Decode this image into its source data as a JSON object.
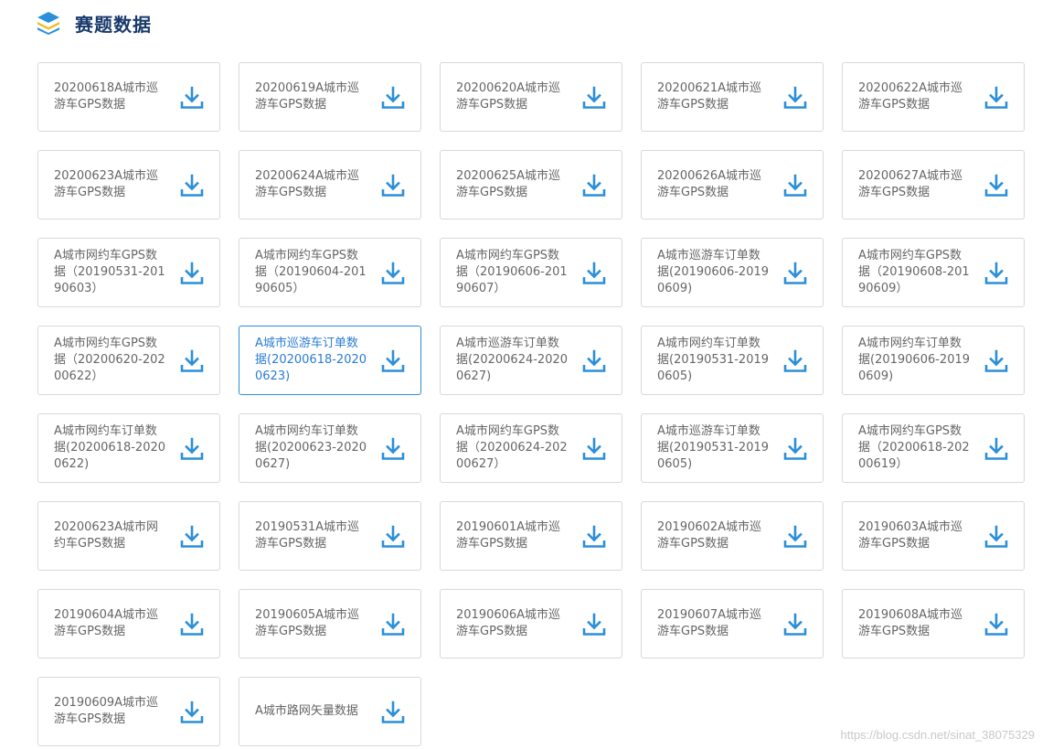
{
  "header": {
    "title": "赛题数据",
    "icon": "layers-icon"
  },
  "accent_color": "#2b8fd9",
  "items": [
    {
      "label": "20200618A城市巡游车GPS数据"
    },
    {
      "label": "20200619A城市巡游车GPS数据"
    },
    {
      "label": "20200620A城市巡游车GPS数据"
    },
    {
      "label": "20200621A城市巡游车GPS数据"
    },
    {
      "label": "20200622A城市巡游车GPS数据"
    },
    {
      "label": "20200623A城市巡游车GPS数据"
    },
    {
      "label": "20200624A城市巡游车GPS数据"
    },
    {
      "label": "20200625A城市巡游车GPS数据"
    },
    {
      "label": "20200626A城市巡游车GPS数据"
    },
    {
      "label": "20200627A城市巡游车GPS数据"
    },
    {
      "label": "A城市网约车GPS数据（20190531-20190603）"
    },
    {
      "label": "A城市网约车GPS数据（20190604-20190605）"
    },
    {
      "label": "A城市网约车GPS数据（20190606-20190607）"
    },
    {
      "label": "A城市巡游车订单数据(20190606-20190609)"
    },
    {
      "label": "A城市网约车GPS数据（20190608-20190609）"
    },
    {
      "label": "A城市网约车GPS数据（20200620-20200622）"
    },
    {
      "label": "A城市巡游车订单数据(20200618-20200623)",
      "active": true
    },
    {
      "label": "A城市巡游车订单数据(20200624-20200627)"
    },
    {
      "label": "A城市网约车订单数据(20190531-20190605)"
    },
    {
      "label": "A城市网约车订单数据(20190606-20190609)"
    },
    {
      "label": "A城市网约车订单数据(20200618-20200622)"
    },
    {
      "label": "A城市网约车订单数据(20200623-20200627)"
    },
    {
      "label": "A城市网约车GPS数据（20200624-20200627）"
    },
    {
      "label": "A城市巡游车订单数据(20190531-20190605)"
    },
    {
      "label": "A城市网约车GPS数据（20200618-20200619）"
    },
    {
      "label": "20200623A城市网约车GPS数据"
    },
    {
      "label": "20190531A城市巡游车GPS数据"
    },
    {
      "label": "20190601A城市巡游车GPS数据"
    },
    {
      "label": "20190602A城市巡游车GPS数据"
    },
    {
      "label": "20190603A城市巡游车GPS数据"
    },
    {
      "label": "20190604A城市巡游车GPS数据"
    },
    {
      "label": "20190605A城市巡游车GPS数据"
    },
    {
      "label": "20190606A城市巡游车GPS数据"
    },
    {
      "label": "20190607A城市巡游车GPS数据"
    },
    {
      "label": "20190608A城市巡游车GPS数据"
    },
    {
      "label": "20190609A城市巡游车GPS数据"
    },
    {
      "label": "A城市路网矢量数据"
    }
  ],
  "watermark": "https://blog.csdn.net/sinat_38075329"
}
